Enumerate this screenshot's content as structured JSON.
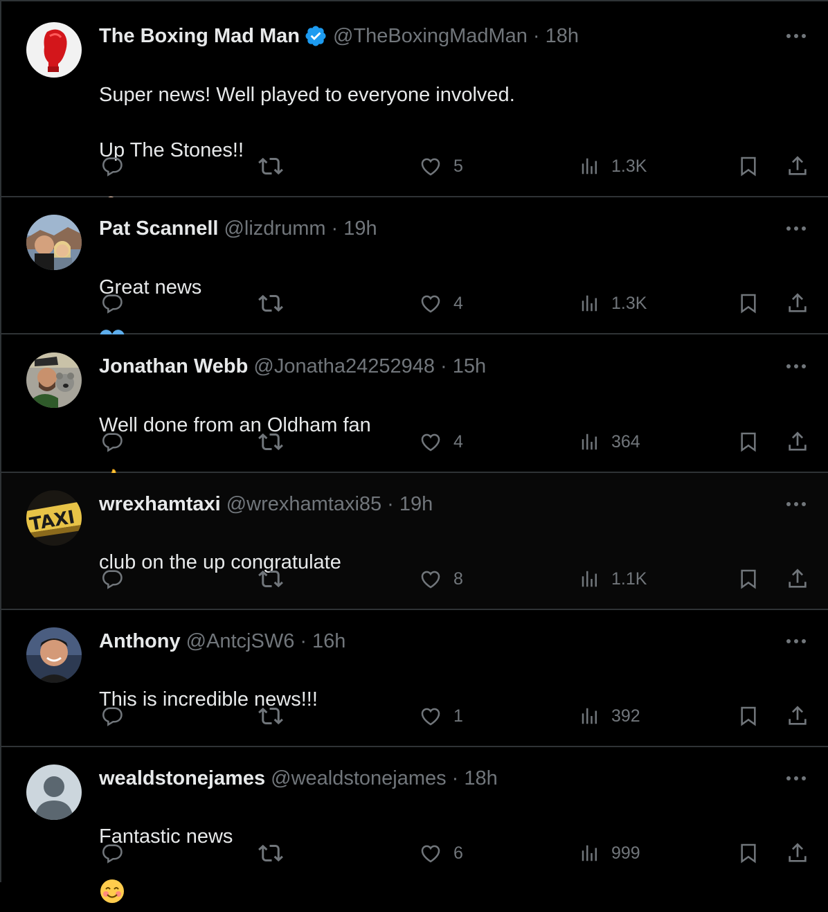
{
  "colors": {
    "background": "#000000",
    "text": "#e7e9ea",
    "muted": "#71767b",
    "divider": "#2f3336",
    "verified": "#1d9bf0"
  },
  "tweets": [
    {
      "name": "The Boxing Mad Man",
      "verified": true,
      "handle": "@TheBoxingMadMan",
      "time": "18h",
      "text": "Super news! Well played to everyone involved.\n\nUp The Stones!!",
      "emoji": "flexed-biceps",
      "likes": "5",
      "views": "1.3K",
      "avatar": "red-boxing-glove"
    },
    {
      "name": "Pat Scannell",
      "verified": false,
      "handle": "@lizdrumm",
      "time": "19h",
      "text": "Great news",
      "emoji": "blue-heart",
      "likes": "4",
      "views": "1.3K",
      "avatar": "couple-photo"
    },
    {
      "name": "Jonathan Webb",
      "verified": false,
      "handle": "@Jonatha24252948",
      "time": "15h",
      "text": "Well done from an Oldham fan",
      "emoji": "thumbs-up",
      "likes": "4",
      "views": "364",
      "avatar": "man-with-koala"
    },
    {
      "name": "wrexhamtaxi",
      "verified": false,
      "handle": "@wrexhamtaxi85",
      "time": "19h",
      "text": "club on the up congratulate",
      "emoji": "",
      "likes": "8",
      "views": "1.1K",
      "avatar": "taxi-sign"
    },
    {
      "name": "Anthony",
      "verified": false,
      "handle": "@AntcjSW6",
      "time": "16h",
      "text": "This is incredible news!!!",
      "emoji": "",
      "likes": "1",
      "views": "392",
      "avatar": "man-portrait"
    },
    {
      "name": "wealdstonejames",
      "verified": false,
      "handle": "@wealdstonejames",
      "time": "18h",
      "text": "Fantastic news",
      "emoji": "smiling-face",
      "likes": "6",
      "views": "999",
      "avatar": "default-profile"
    }
  ]
}
